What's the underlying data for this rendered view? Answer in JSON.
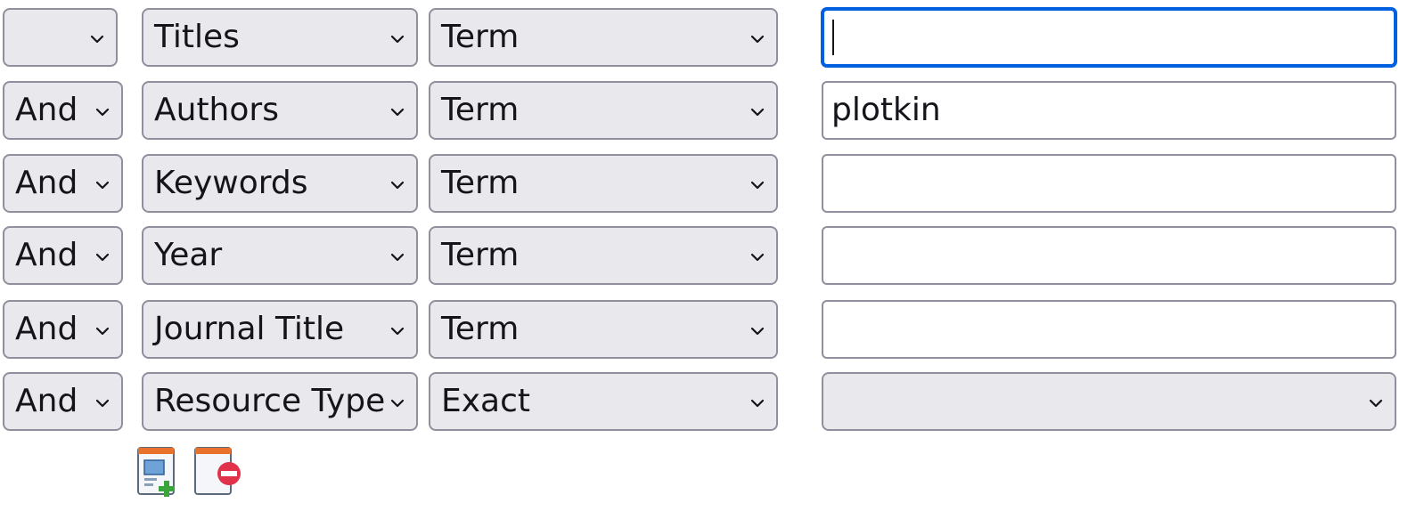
{
  "rows": [
    {
      "bool": "",
      "field": "Titles",
      "mode": "Term",
      "value": ""
    },
    {
      "bool": "And",
      "field": "Authors",
      "mode": "Term",
      "value": "plotkin"
    },
    {
      "bool": "And",
      "field": "Keywords",
      "mode": "Term",
      "value": ""
    },
    {
      "bool": "And",
      "field": "Year",
      "mode": "Term",
      "value": ""
    },
    {
      "bool": "And",
      "field": "Journal Title",
      "mode": "Term",
      "value": ""
    },
    {
      "bool": "And",
      "field": "Resource Type",
      "mode": "Exact",
      "value": ""
    }
  ],
  "icons": {
    "add_row": "add-search-row-icon",
    "remove_row": "remove-search-row-icon"
  },
  "colors": {
    "select_bg": "#e9e9ed",
    "border": "#8f8f9d",
    "focus": "#0060df",
    "add_green": "#3aa53a",
    "remove_red": "#e0334a"
  }
}
